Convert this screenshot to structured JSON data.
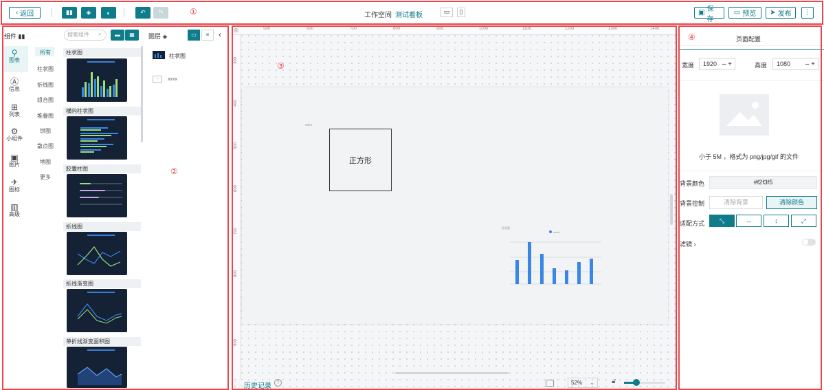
{
  "toolbar": {
    "back_label": "返回",
    "workspace_label": "工作空间",
    "board_name": "测试看板",
    "save_label": "保存",
    "preview_label": "预览",
    "publish_label": "发布",
    "more_label": "⋮"
  },
  "markers": [
    "①",
    "②",
    "③",
    "④"
  ],
  "component_panel": {
    "title": "组件",
    "search_placeholder": "搜索组件",
    "categories": [
      {
        "label": "图表",
        "icon": "chart-icon"
      },
      {
        "label": "信息",
        "icon": "info-icon"
      },
      {
        "label": "列表",
        "icon": "table-icon"
      },
      {
        "label": "小组件",
        "icon": "widget-icon"
      },
      {
        "label": "图片",
        "icon": "image-icon"
      },
      {
        "label": "图标",
        "icon": "icon-icon"
      },
      {
        "label": "高级",
        "icon": "advanced-icon"
      }
    ],
    "subcategories": [
      "所有",
      "柱状图",
      "折线图",
      "组合图",
      "堆叠图",
      "饼图",
      "散点图",
      "地图",
      "更多"
    ],
    "cards": [
      "柱状图",
      "横向柱状图",
      "胶囊柱图",
      "折线图",
      "折线渐变图",
      "单折线渐变面积图"
    ]
  },
  "layers_panel": {
    "title": "图层",
    "items": [
      {
        "label": "柱状图"
      },
      {
        "label": "xxxx"
      }
    ]
  },
  "canvas": {
    "ruler_x": [
      "500",
      "600",
      "700",
      "800",
      "900",
      "1000",
      "1100",
      "1200",
      "1300",
      "1400"
    ],
    "ruler_y": [
      "300",
      "400",
      "500",
      "600",
      "700",
      "800",
      "900"
    ],
    "square_label": "正方形",
    "small_text": "xxxx",
    "mini_chart_title": "柱状图",
    "mini_chart_legend": "data1",
    "history_label": "历史记录",
    "zoom_value": "52%"
  },
  "page_config": {
    "title": "页面配置",
    "width_label": "宽度",
    "width_value": "1920",
    "height_label": "高度",
    "height_value": "1080",
    "upload_hint": "小于 5M ，格式为 png/jpg/gif 的文件",
    "bg_color_label": "背景颜色",
    "bg_color_value": "#f2f3f5",
    "bg_control_label": "背景控制",
    "clear_bg_label": "清除背景",
    "clear_color_label": "清除颜色",
    "fit_label": "适配方式",
    "filter_label": "滤镜"
  },
  "colors": {
    "accent": "#0f7c8c",
    "annotation": "#e8474e"
  }
}
